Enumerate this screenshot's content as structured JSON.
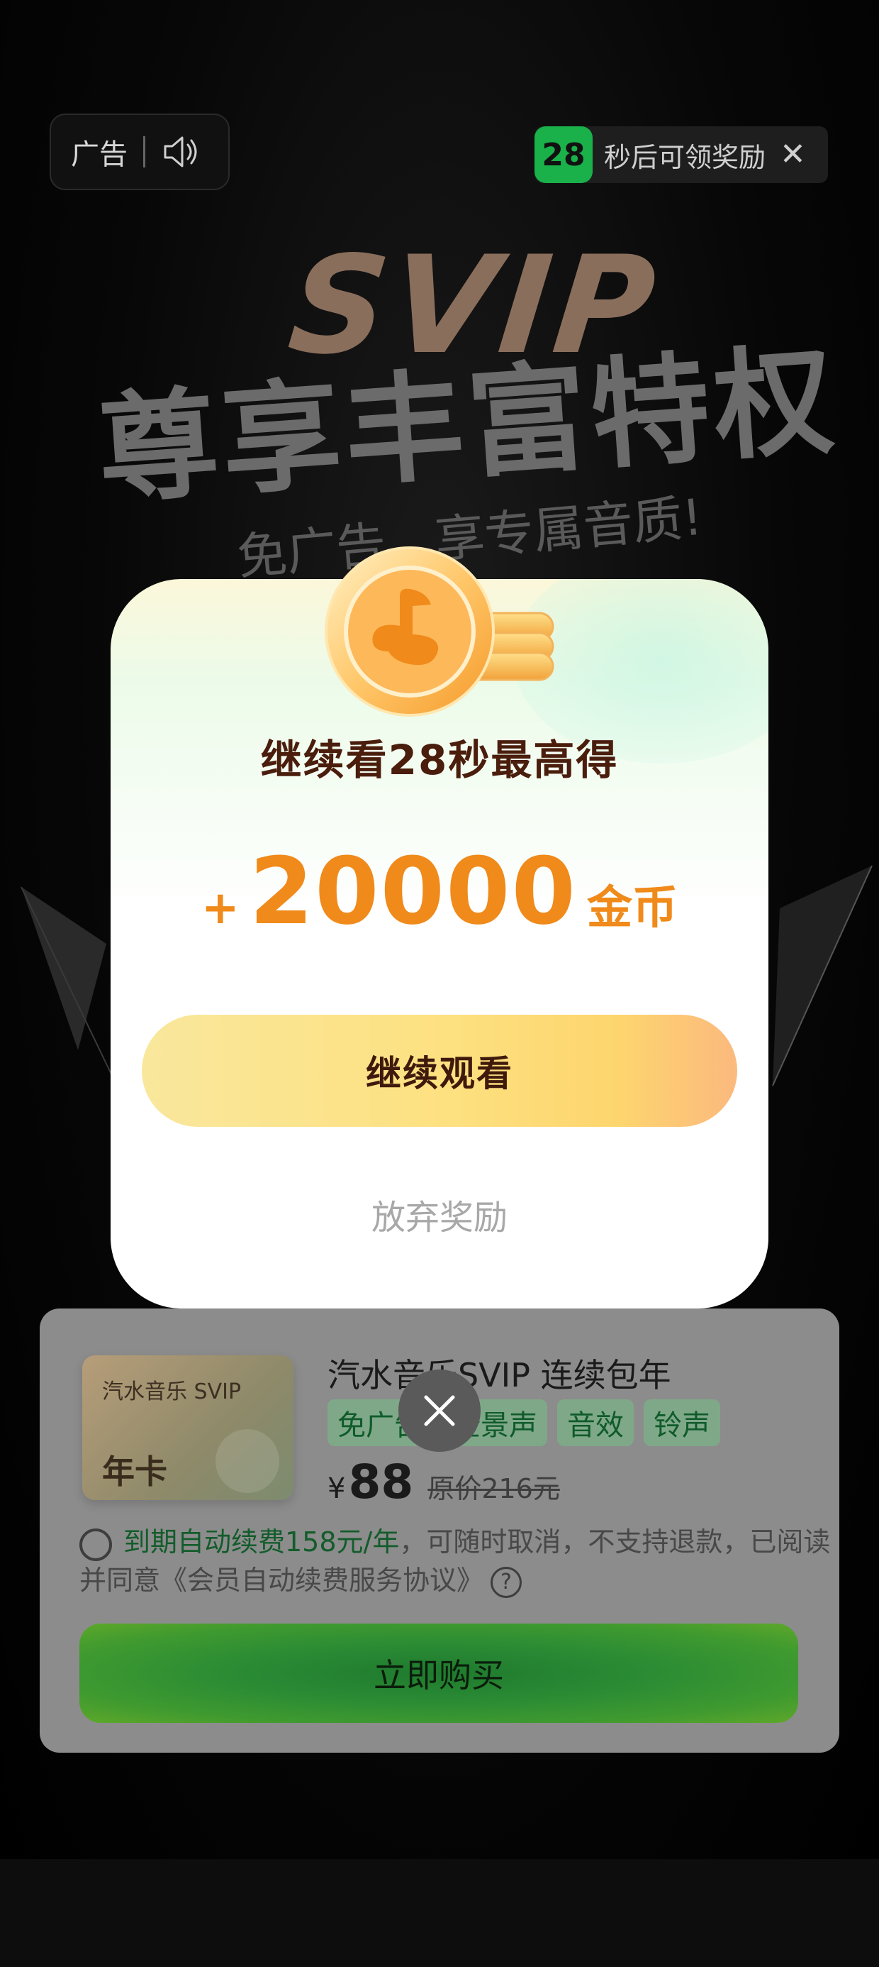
{
  "ad": {
    "label": "广告",
    "countdown_seconds": "28",
    "countdown_text": "秒后可领奖励",
    "close_glyph": "✕"
  },
  "promo": {
    "brand": "SVIP",
    "headline": "尊享丰富特权",
    "tagline": "免广告，享专属音质!"
  },
  "modal": {
    "headline": "继续看28秒最高得",
    "reward_plus": "+",
    "reward_amount": "20000",
    "reward_unit": "金币",
    "continue_button": "继续观看",
    "abandon_link": "放弃奖励"
  },
  "product": {
    "thumb_brand": "汽水音乐 SVIP",
    "thumb_type": "年卡",
    "title": "汽水音乐SVIP 连续包年",
    "tags": [
      "免广告",
      "全景声",
      "音效",
      "铃声"
    ],
    "price_symbol": "¥",
    "price": "88",
    "original_price": "原价216元",
    "agreement_highlight": "到期自动续费158元/年",
    "agreement_rest": "，可随时取消，不支持退款，已阅读并同意《会员自动续费服务协议》",
    "help_glyph": "?",
    "buy_button": "立即购买"
  },
  "colors": {
    "accent_green": "#1ab04a",
    "reward_orange": "#f08a1a",
    "headline_brown": "#4a1d0c"
  },
  "icons": [
    "speaker-icon",
    "close-icon",
    "coin-icon",
    "help-icon"
  ]
}
